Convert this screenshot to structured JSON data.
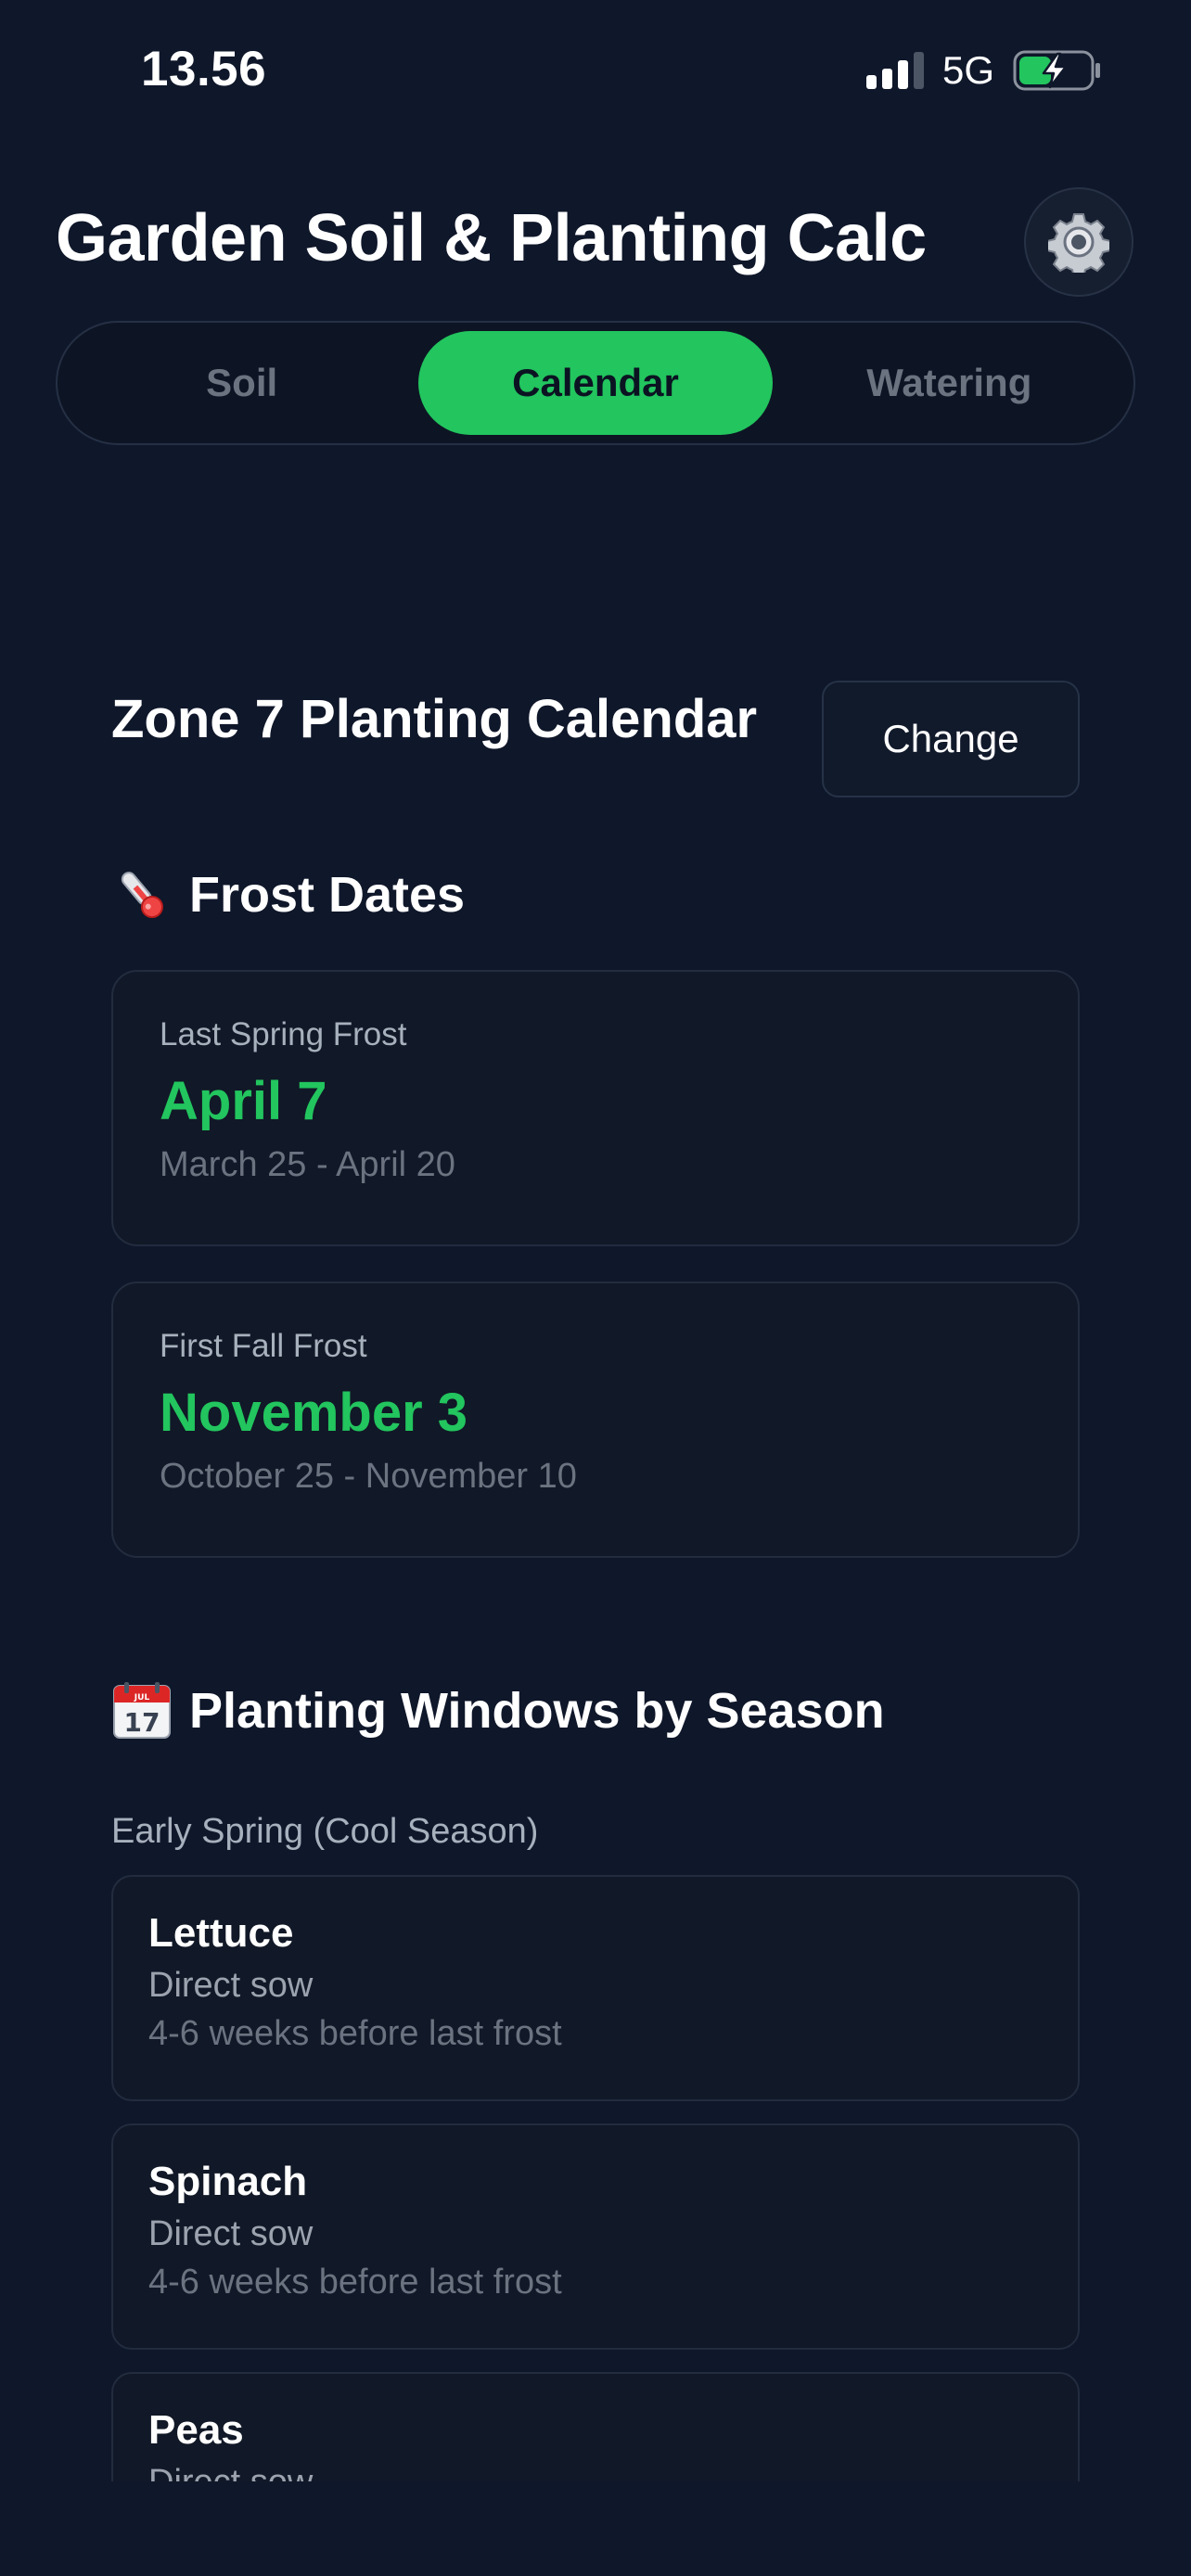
{
  "status_bar": {
    "time": "13.56",
    "network": "5G"
  },
  "header": {
    "title": "Garden Soil & Planting Calc",
    "settings_icon": "gear-icon"
  },
  "tabs": [
    {
      "label": "Soil",
      "active": false
    },
    {
      "label": "Calendar",
      "active": true
    },
    {
      "label": "Watering",
      "active": false
    }
  ],
  "calendar": {
    "title": "Zone 7 Planting Calendar",
    "change_label": "Change",
    "frost_heading": {
      "icon": "thermometer-icon",
      "label": "Frost Dates"
    },
    "last_spring_frost": {
      "label": "Last Spring Frost",
      "date": "April 7",
      "range": "March 25 - April 20"
    },
    "first_fall_frost": {
      "label": "First Fall Frost",
      "date": "November 3",
      "range": "October 25 - November 10"
    },
    "windows_heading": {
      "icon": "calendar-icon",
      "label": "Planting Windows by Season"
    },
    "season_label": "Early Spring (Cool Season)",
    "crops": [
      {
        "name": "Lettuce",
        "method": "Direct sow",
        "timing": "4-6 weeks before last frost"
      },
      {
        "name": "Spinach",
        "method": "Direct sow",
        "timing": "4-6 weeks before last frost"
      },
      {
        "name": "Peas",
        "method": "Direct sow",
        "timing": ""
      }
    ]
  },
  "colors": {
    "background": "#0f172a",
    "accent": "#22c55e",
    "card": "#111827"
  }
}
